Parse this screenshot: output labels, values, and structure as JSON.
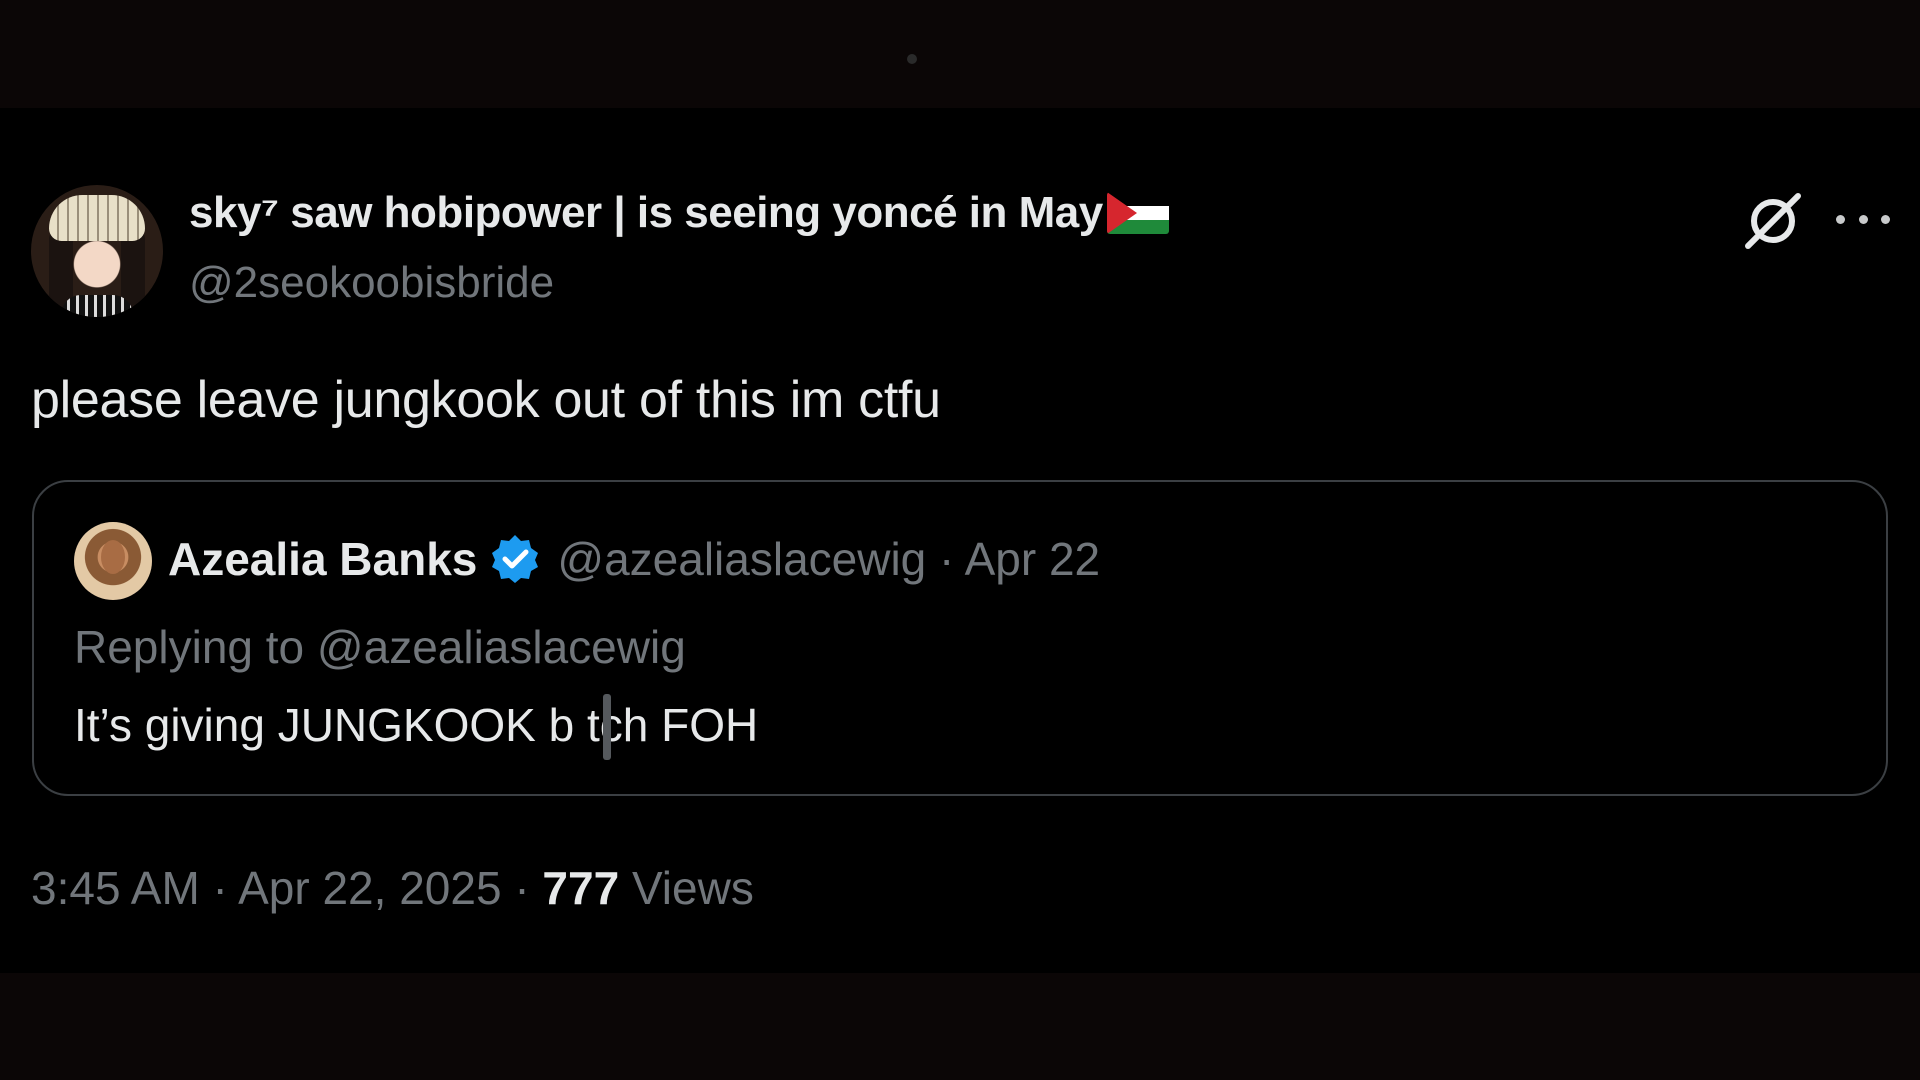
{
  "tweet": {
    "author": {
      "display_name": "sky⁷ saw hobipower | is seeing yoncé in May",
      "flag_icon": "palestine-flag-icon",
      "handle": "@2seokoobisbride"
    },
    "text": "please leave jungkook out of this im ctfu",
    "actions": {
      "grok_icon": "grok-icon",
      "more_icon": "more-options-icon"
    },
    "quoted": {
      "display_name": "Azealia Banks",
      "verified_icon": "verified-badge-icon",
      "verified_color": "#1d9bf0",
      "handle_and_date": "@azealiaslacewig · Apr 22",
      "replying_to": "Replying to @azealiaslacewig",
      "text": "It’s giving JUNGKOOK b tch FOH"
    },
    "meta": {
      "time_date": "3:45 AM · Apr 22, 2025 · ",
      "views_count": "777",
      "views_label": " Views"
    }
  },
  "colors": {
    "background": "#000000",
    "primary_text": "#e7e9ea",
    "secondary_text": "#71767b",
    "border": "#3b3f43"
  }
}
